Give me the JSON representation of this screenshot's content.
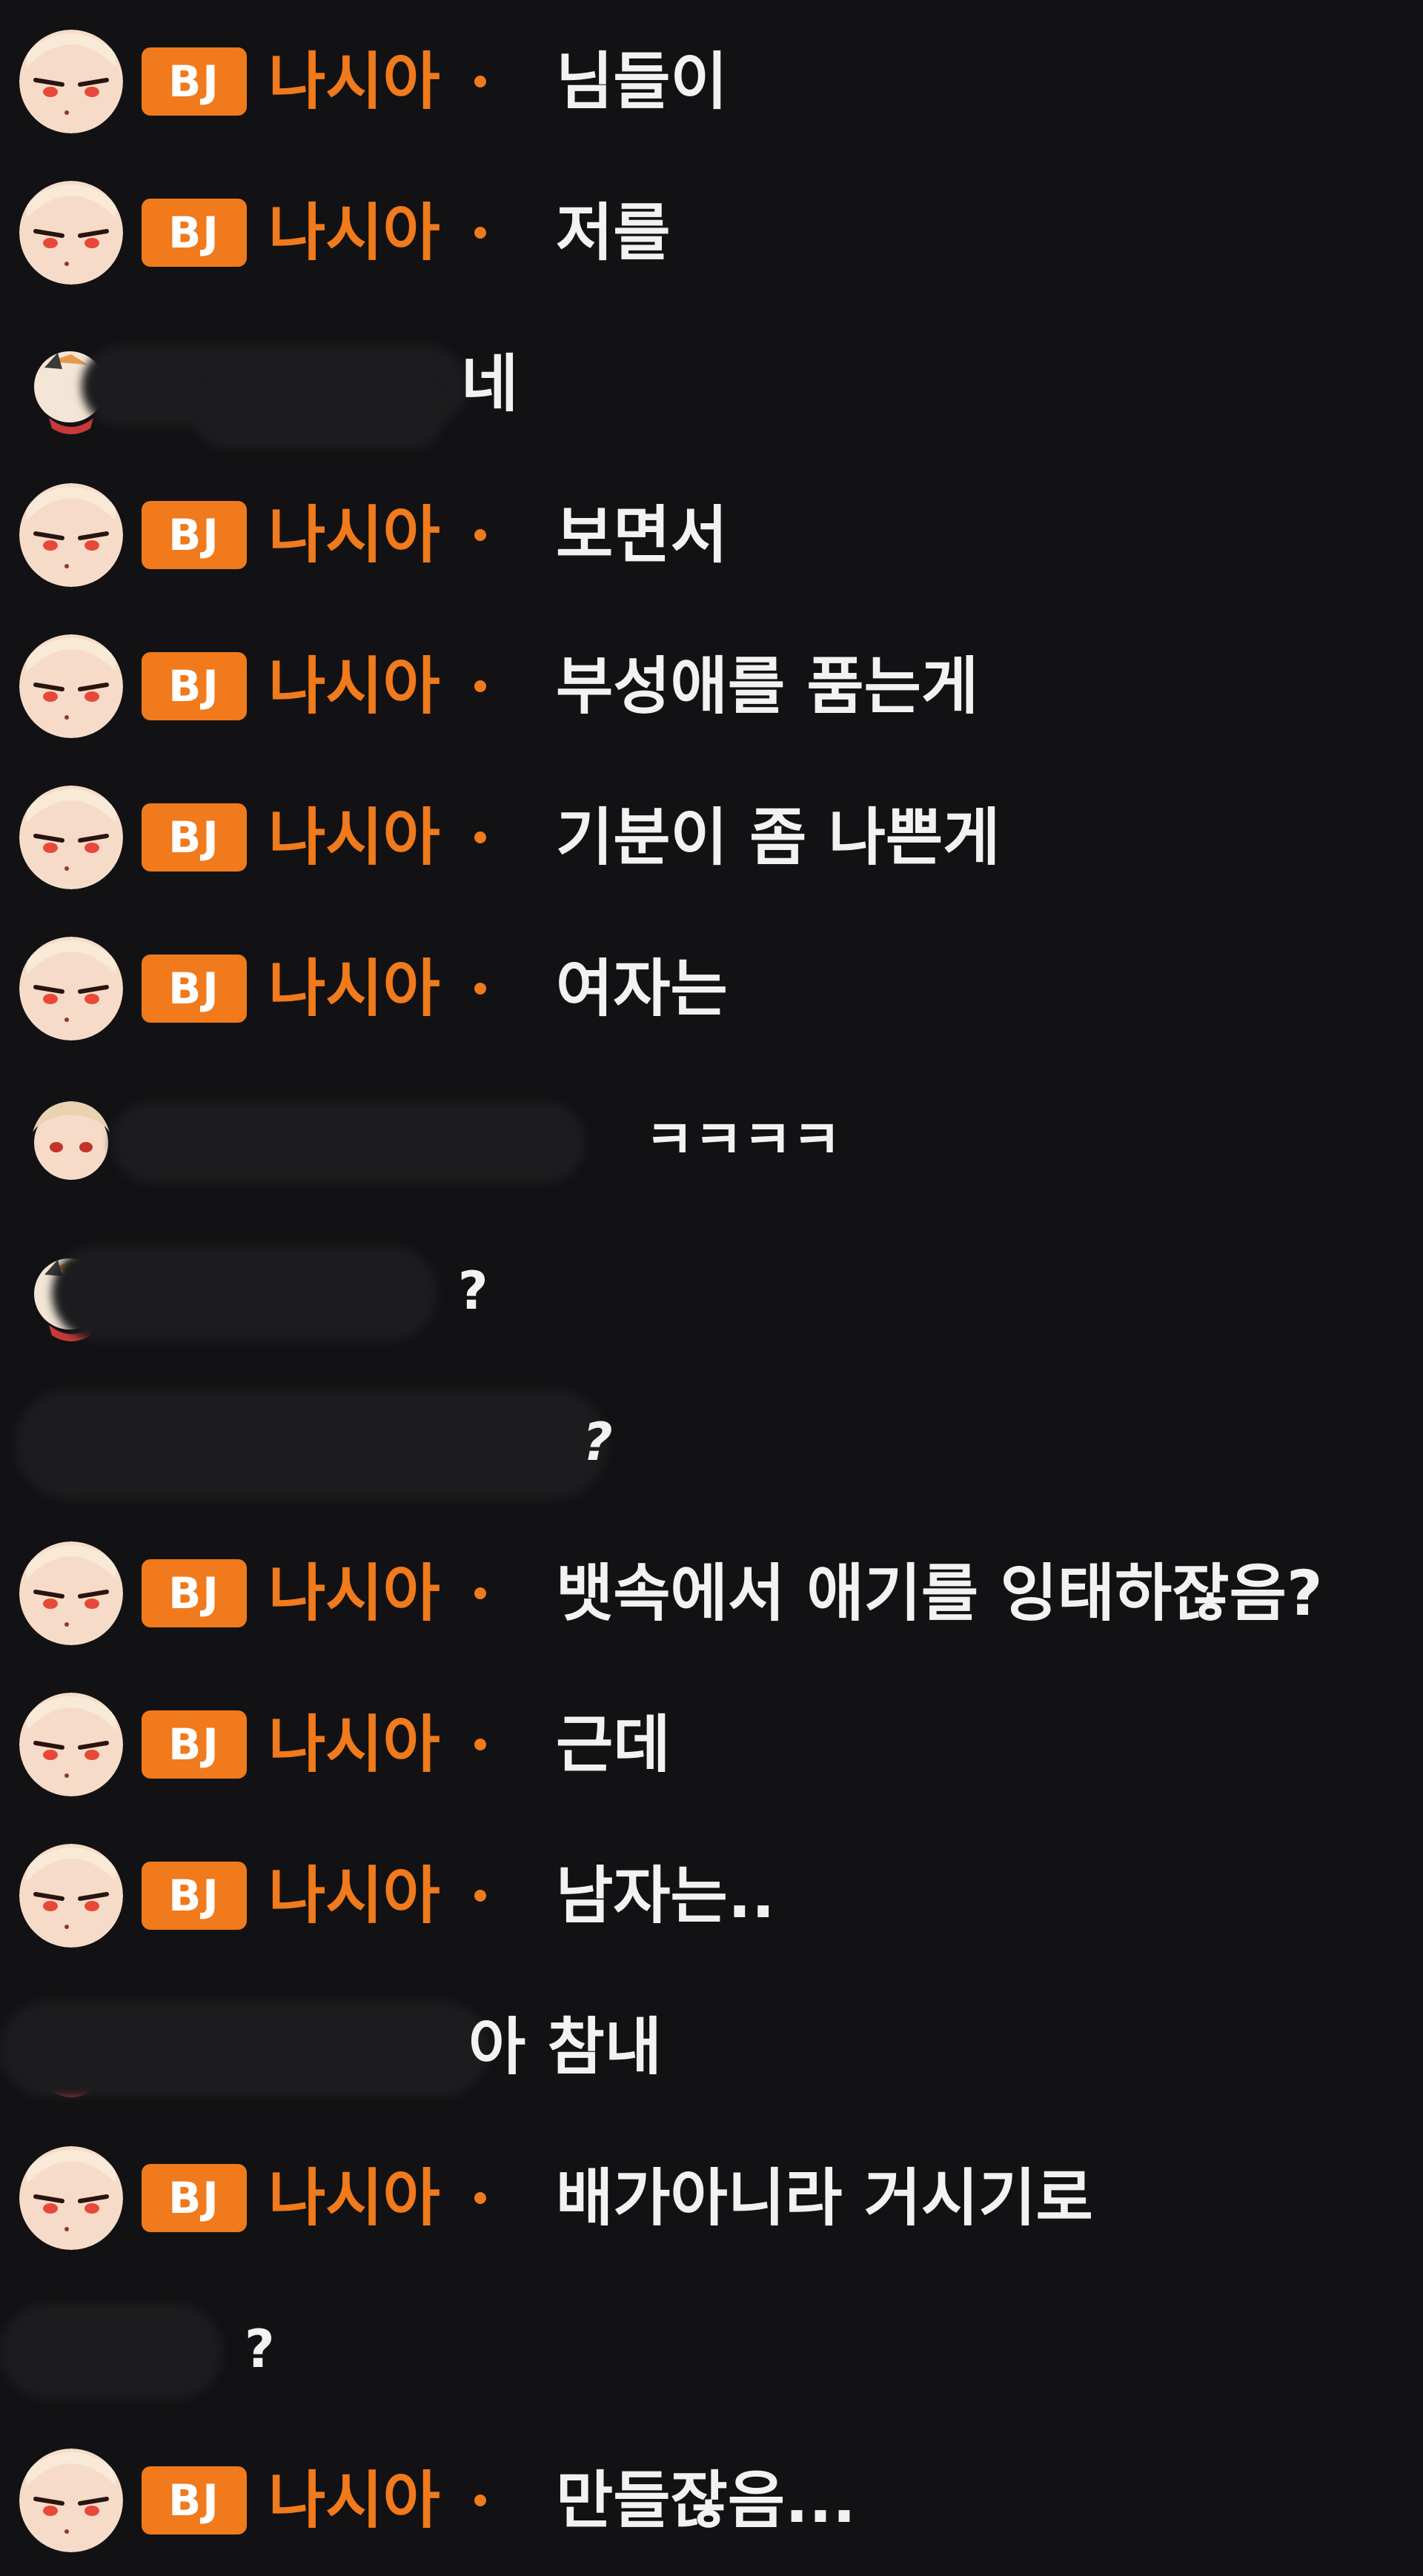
{
  "badge_label": "BJ",
  "streamer_name": "나시아",
  "colors": {
    "background": "#121214",
    "accent": "#f07a1c",
    "message_text": "#f2f2f2"
  },
  "messages": [
    {
      "text": "님들이"
    },
    {
      "text": "저를"
    },
    {
      "text": "네"
    },
    {
      "text": "보면서"
    },
    {
      "text": "부성애를 품는게"
    },
    {
      "text": "기분이 좀 나쁜게"
    },
    {
      "text": "여자는"
    },
    {
      "text": "ㅋㅋㅋㅋ"
    },
    {
      "text": "?"
    },
    {
      "text": "?"
    },
    {
      "text": "뱃속에서 애기를 잉태하잖음?"
    },
    {
      "text": "근데"
    },
    {
      "text": "남자는.."
    },
    {
      "text": "아 참내"
    },
    {
      "text": "배가아니라 거시기로"
    },
    {
      "text": "?"
    },
    {
      "text": "만들잖음..."
    }
  ]
}
